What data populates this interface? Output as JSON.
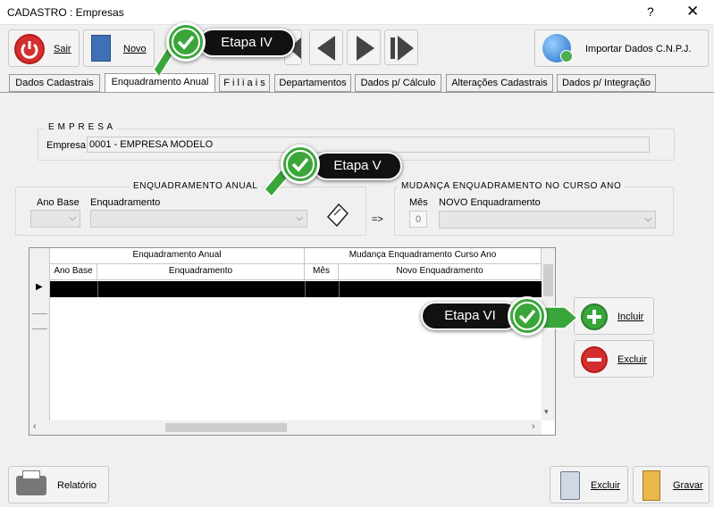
{
  "window": {
    "title": "CADASTRO : Empresas",
    "help": "?",
    "close": "✕"
  },
  "toolbar": {
    "sair": "Sair",
    "novo": "Novo",
    "importar": "Importar Dados C.N.P.J."
  },
  "tabs": [
    {
      "label": "Dados  Cadastrais"
    },
    {
      "label": "Enquadramento Anual"
    },
    {
      "label": "F i l i a i s"
    },
    {
      "label": "Departamentos"
    },
    {
      "label": "Dados p/ Cálculo"
    },
    {
      "label": "Alterações Cadastrais"
    },
    {
      "label": "Dados p/ Integração"
    }
  ],
  "empresa": {
    "group": "E M P R E S A",
    "label": "Empresa",
    "value": "0001 - EMPRESA MODELO"
  },
  "enquadramento": {
    "group": "ENQUADRAMENTO   ANUAL",
    "ano_base": "Ano Base",
    "enquadramento": "Enquadramento",
    "arrow": "=>"
  },
  "mudanca": {
    "group": "MUDANÇA  ENQUADRAMENTO  NO  CURSO  ANO",
    "mes": "Mês",
    "mes_value": "0",
    "novo": "NOVO  Enquadramento"
  },
  "grid": {
    "group1": "Enquadramento Anual",
    "group2": "Mudança Enquadramento Curso Ano",
    "columns": [
      "Ano Base",
      "Enquadramento",
      "Mês",
      "Novo Enquadramento"
    ]
  },
  "side": {
    "incluir": "Incluir",
    "excluir": "Excluir"
  },
  "footer": {
    "relatorio": "Relatório",
    "excluir": "Excluir",
    "gravar": "Gravar"
  },
  "callouts": {
    "c4": "Etapa IV",
    "c5": "Etapa V",
    "c6": "Etapa VI"
  },
  "colors": {
    "accent_green": "#3aa63a",
    "callout_bg": "#111111",
    "red_button": "#d32f2f"
  }
}
